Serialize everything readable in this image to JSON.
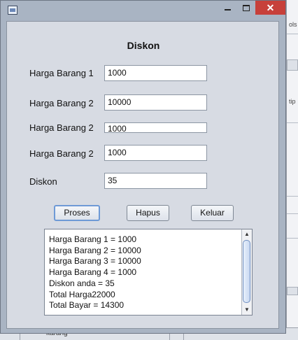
{
  "window": {
    "close_glyph": "✕"
  },
  "background": {
    "right_frag_1": "ols",
    "right_frag_2": "tip",
    "bottom_frag": "karang"
  },
  "form": {
    "title": "Diskon",
    "fields": [
      {
        "label": "Harga Barang 1",
        "value": "1000"
      },
      {
        "label": "Harga Barang 2",
        "value": "10000"
      },
      {
        "label": "Harga Barang 2",
        "value": "1000"
      },
      {
        "label": "Harga Barang 2",
        "value": "1000"
      },
      {
        "label": "Diskon",
        "value": "35"
      }
    ],
    "buttons": {
      "proses": "Proses",
      "hapus": "Hapus",
      "keluar": "Keluar"
    }
  },
  "output": {
    "lines": [
      "Harga Barang 1 = 1000",
      "Harga Barang 2 = 10000",
      "Harga Barang 3 = 10000",
      "Harga Barang 4 = 1000",
      "Diskon anda = 35",
      "Total Harga22000",
      "Total Bayar = 14300"
    ],
    "scroll_up": "▲",
    "scroll_down": "▼"
  }
}
